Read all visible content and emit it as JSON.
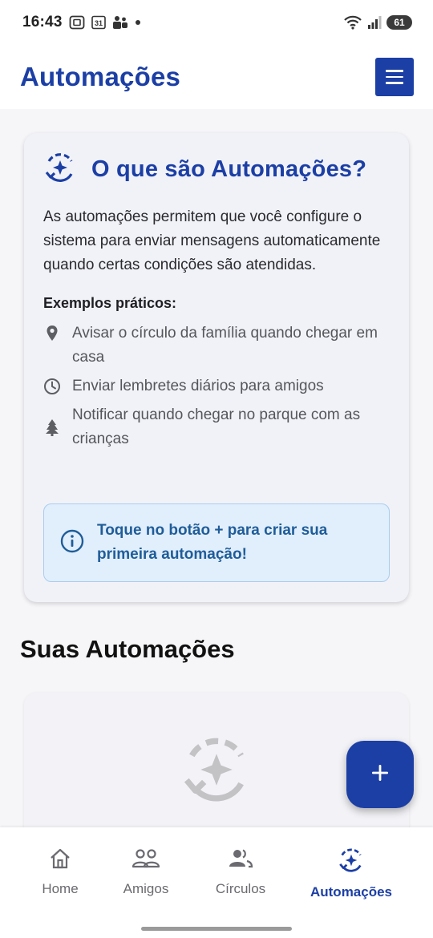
{
  "status_bar": {
    "time": "16:43",
    "calendar_day": "31",
    "battery": "61"
  },
  "app_bar": {
    "title": "Automações"
  },
  "info_card": {
    "title": "O que são Automações?",
    "description": "As automações permitem que você configure o sistema para enviar mensagens automaticamente quando certas condições são atendidas.",
    "examples_label": "Exemplos práticos:",
    "examples": [
      {
        "icon": "location-pin-icon",
        "text": "Avisar o círculo da família quando chegar em casa"
      },
      {
        "icon": "clock-icon",
        "text": "Enviar lembretes diários para amigos"
      },
      {
        "icon": "tree-icon",
        "text": "Notificar quando chegar no parque com as crianças"
      }
    ],
    "tip": "Toque no botão + para criar sua primeira automação!"
  },
  "section": {
    "title": "Suas Automações"
  },
  "bottom_nav": {
    "items": [
      {
        "label": "Home",
        "icon": "home-icon"
      },
      {
        "label": "Amigos",
        "icon": "friends-icon"
      },
      {
        "label": "Círculos",
        "icon": "circles-icon"
      },
      {
        "label": "Automações",
        "icon": "automation-icon",
        "active": true
      }
    ]
  },
  "colors": {
    "primary": "#1c3fa5",
    "tip_background": "#e1eefc",
    "tip_text": "#1f5d99"
  }
}
